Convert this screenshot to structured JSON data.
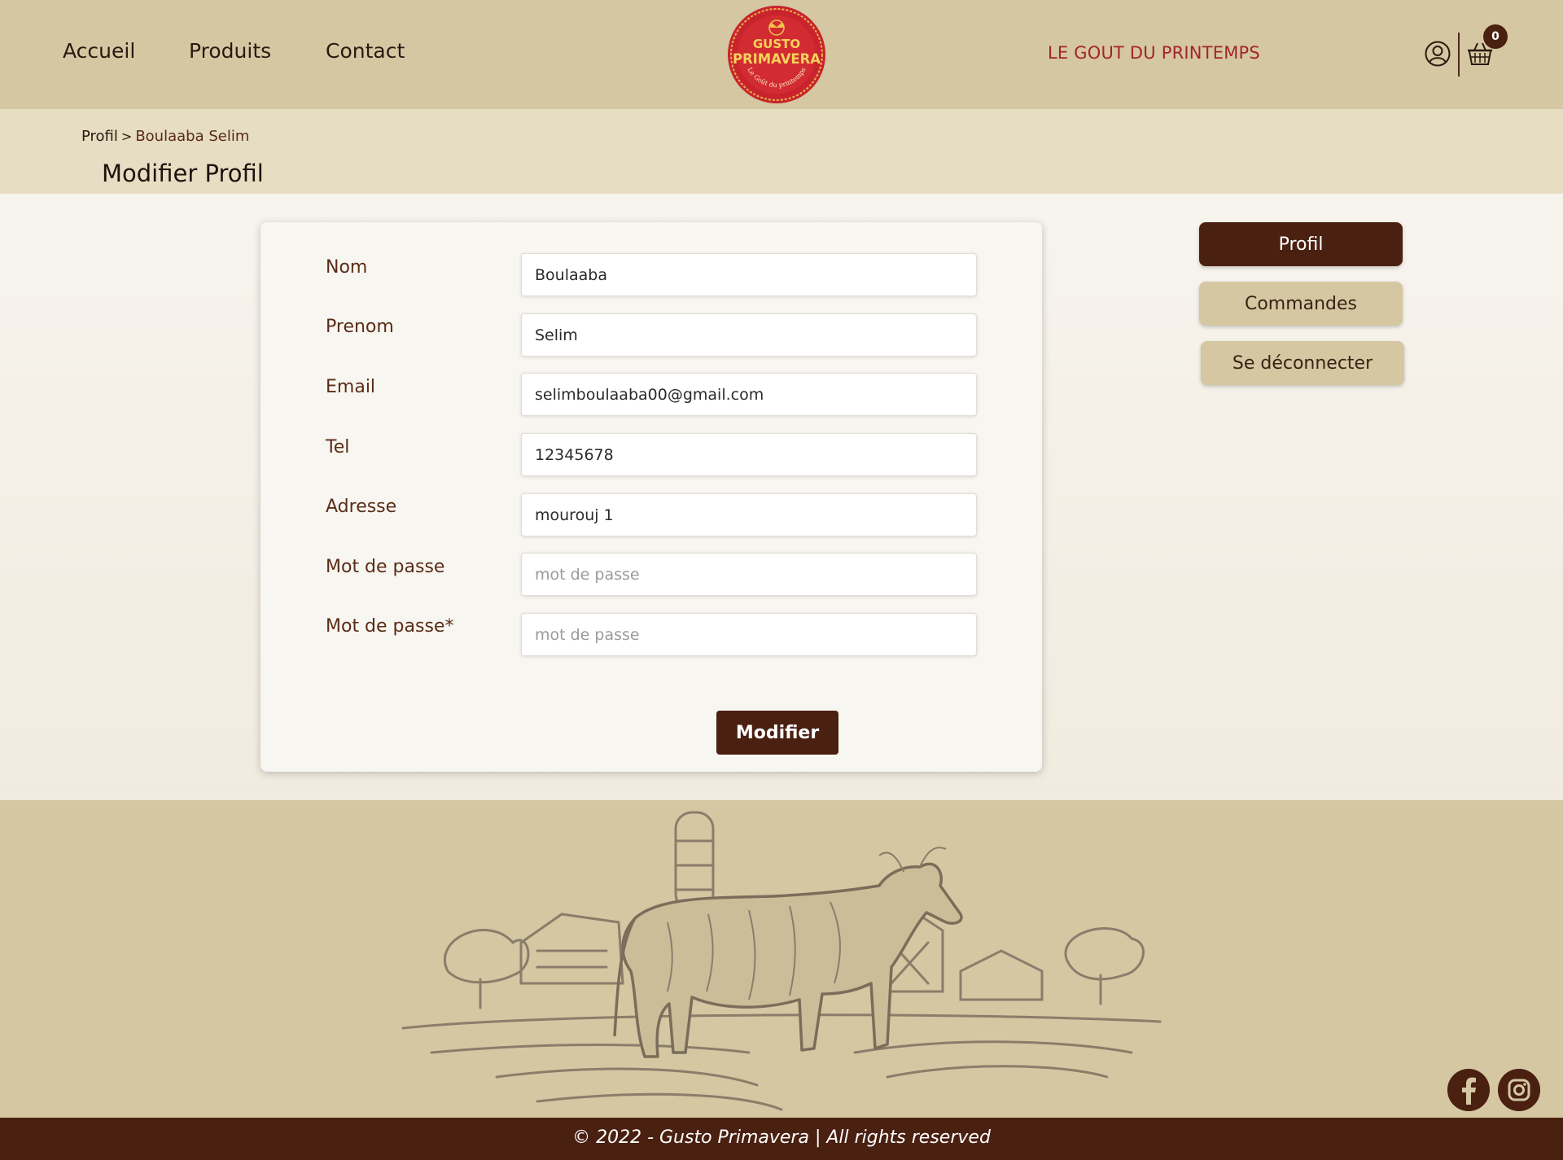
{
  "header": {
    "nav": [
      "Accueil",
      "Produits",
      "Contact"
    ],
    "logo": {
      "brand_top": "GUSTO",
      "brand_main": "PRIMAVERA",
      "brand_sub": "Le Goût du printemps"
    },
    "tagline": "LE GOUT DU PRINTEMPS",
    "cart_count": "0",
    "icons": {
      "user": "user-icon",
      "cart": "basket-icon"
    }
  },
  "breadcrumb": {
    "root": "Profil",
    "separator": ">",
    "current": "Boulaaba Selim"
  },
  "page_title": "Modifier Profil",
  "form": {
    "fields": [
      {
        "label": "Nom",
        "value": "Boulaaba",
        "placeholder": ""
      },
      {
        "label": "Prenom",
        "value": "Selim",
        "placeholder": ""
      },
      {
        "label": "Email",
        "value": "selimboulaaba00@gmail.com",
        "placeholder": ""
      },
      {
        "label": "Tel",
        "value": "12345678",
        "placeholder": ""
      },
      {
        "label": "Adresse",
        "value": "mourouj 1",
        "placeholder": ""
      },
      {
        "label": "Mot de passe",
        "value": "",
        "placeholder": "mot de passe"
      },
      {
        "label": "Mot de passe*",
        "value": "",
        "placeholder": "mot de passe"
      }
    ],
    "submit_label": "Modifier"
  },
  "sidebar": {
    "profil": "Profil",
    "commandes": "Commandes",
    "deconnecter": "Se déconnecter"
  },
  "footer": {
    "social": [
      "facebook-icon",
      "instagram-icon"
    ],
    "copyright": "© 2022 - Gusto Primavera | All rights reserved"
  },
  "colors": {
    "header_bg": "#d4c7a2",
    "band_bg": "#e6ddc3",
    "brand_dark": "#4a2011",
    "tagline_red": "#a3252a",
    "logo_red": "#c9232d"
  }
}
